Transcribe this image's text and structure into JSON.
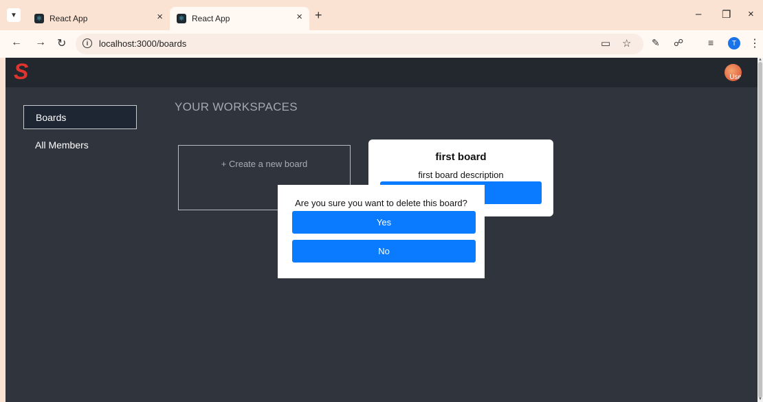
{
  "browser": {
    "tabs": [
      {
        "title": "React App",
        "active": false
      },
      {
        "title": "React App",
        "active": true
      }
    ],
    "url": "localhost:3000/boards",
    "profile_initial": "T"
  },
  "app": {
    "user_avatar_text": "Use",
    "sidebar": {
      "items": [
        {
          "label": "Boards",
          "active": true
        },
        {
          "label": "All Members",
          "active": false
        }
      ]
    },
    "workspace_title": "YOUR WORKSPACES",
    "create_board_label": "+ Create a new board",
    "boards": [
      {
        "title": "first board",
        "description": "first board description"
      }
    ],
    "dialog": {
      "message": "Are you sure you want to delete this board?",
      "yes_label": "Yes",
      "no_label": "No"
    },
    "colors": {
      "accent": "#0a7bff",
      "logo": "#e0352f",
      "background": "#2f343d",
      "navbar": "#23272e"
    }
  }
}
